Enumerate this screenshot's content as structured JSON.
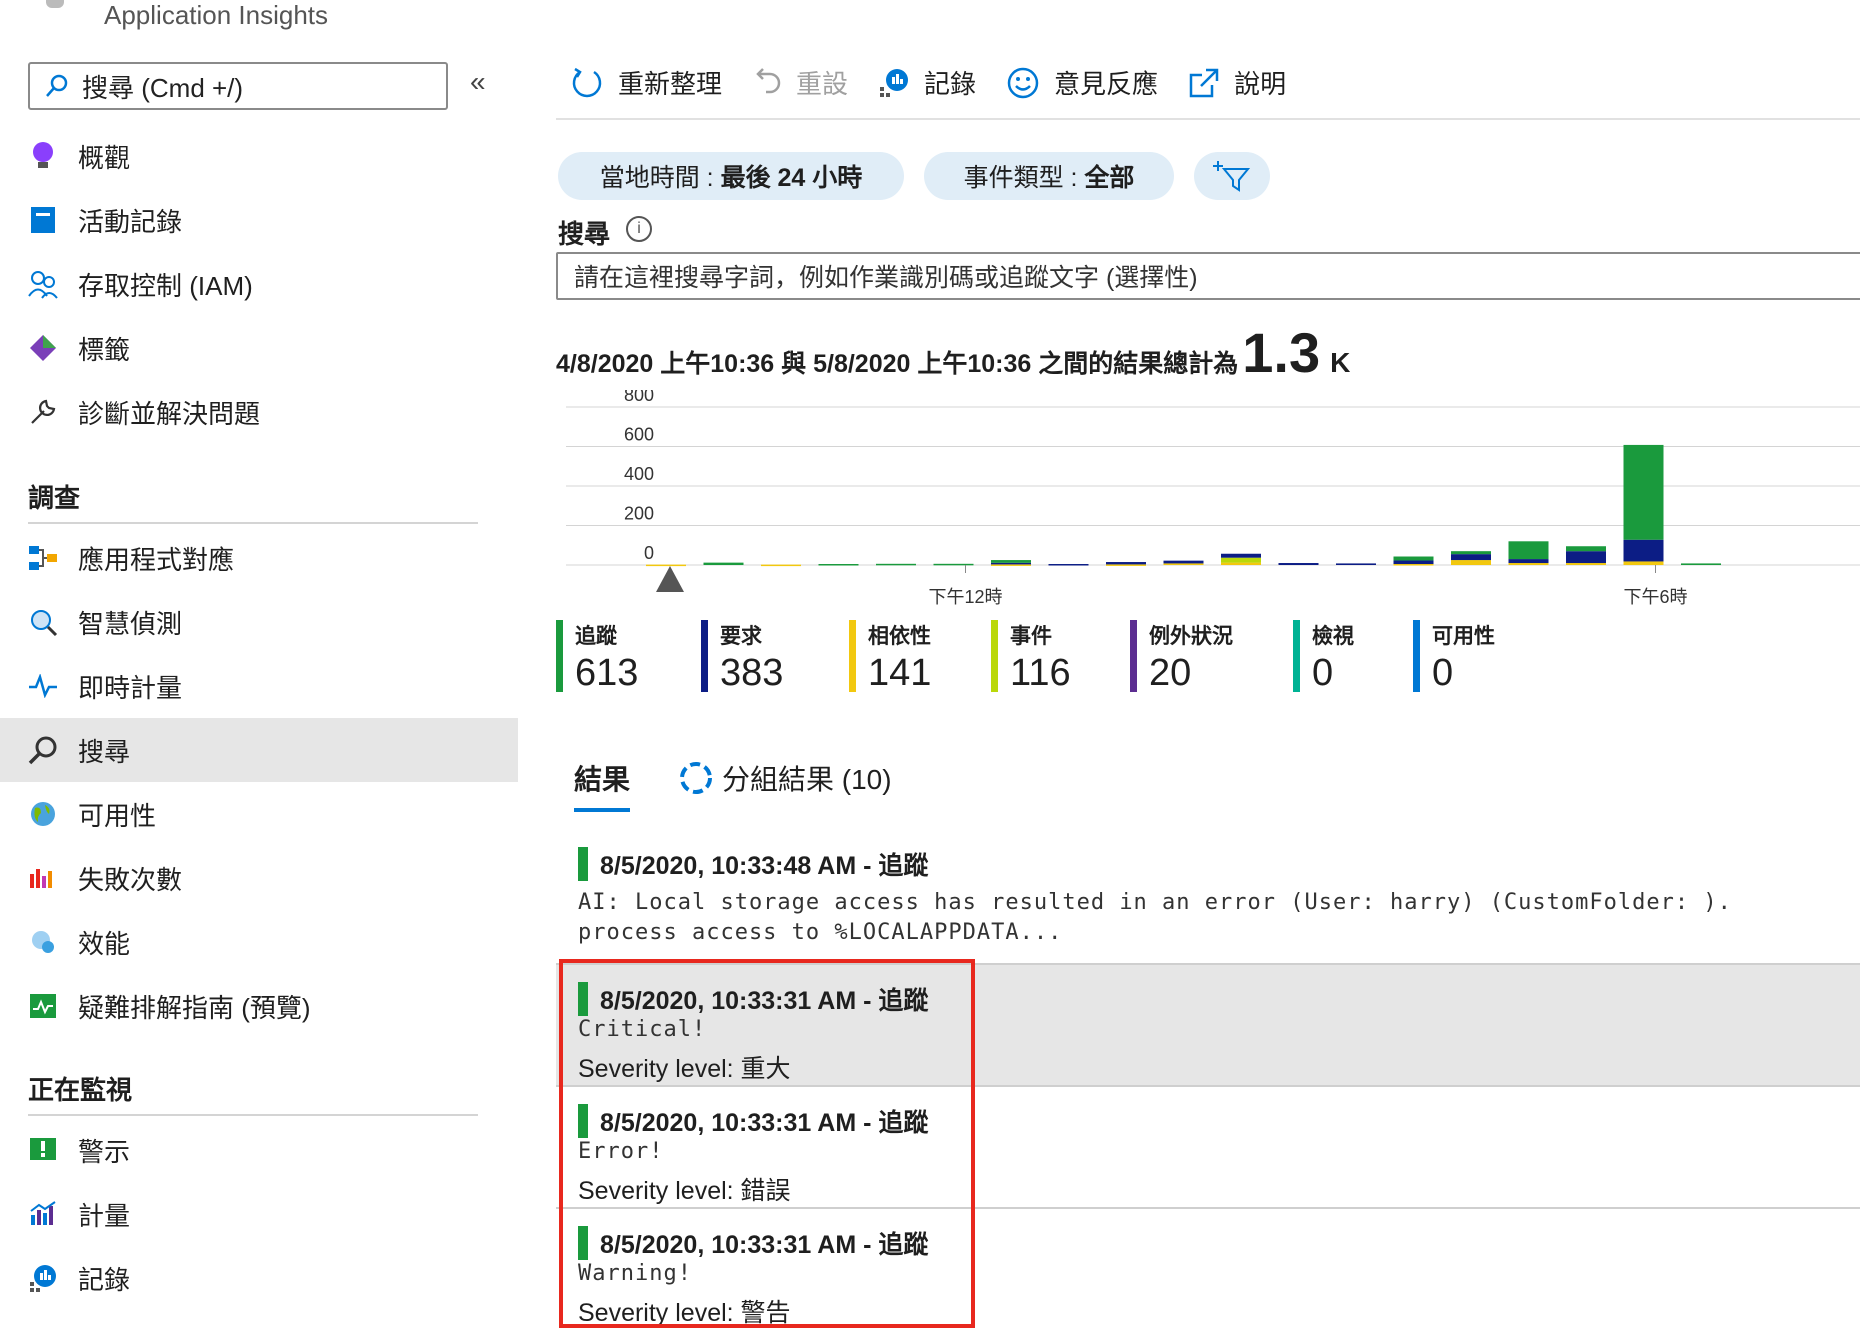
{
  "app": {
    "title": "Application Insights"
  },
  "sidebar": {
    "search_placeholder": "搜尋 (Cmd +/)",
    "collapse": "«",
    "items_top": [
      {
        "label": "概觀",
        "icon": "lightbulb-icon"
      },
      {
        "label": "活動記錄",
        "icon": "activity-log-icon"
      },
      {
        "label": "存取控制 (IAM)",
        "icon": "people-icon"
      },
      {
        "label": "標籤",
        "icon": "tag-icon"
      },
      {
        "label": "診斷並解決問題",
        "icon": "wrench-icon"
      }
    ],
    "section_investigate": "調查",
    "items_investigate": [
      {
        "label": "應用程式對應",
        "icon": "app-map-icon"
      },
      {
        "label": "智慧偵測",
        "icon": "smart-detection-icon"
      },
      {
        "label": "即時計量",
        "icon": "pulse-icon"
      },
      {
        "label": "搜尋",
        "icon": "search-icon"
      },
      {
        "label": "可用性",
        "icon": "globe-icon"
      },
      {
        "label": "失敗次數",
        "icon": "failures-icon"
      },
      {
        "label": "效能",
        "icon": "performance-icon"
      },
      {
        "label": "疑難排解指南 (預覽)",
        "icon": "troubleshoot-icon"
      }
    ],
    "section_monitoring": "正在監視",
    "items_monitoring": [
      {
        "label": "警示",
        "icon": "alert-icon"
      },
      {
        "label": "計量",
        "icon": "metrics-icon"
      },
      {
        "label": "記錄",
        "icon": "logs-icon"
      }
    ]
  },
  "toolbar": {
    "refresh": "重新整理",
    "reset": "重設",
    "logs": "記錄",
    "feedback": "意見反應",
    "help": "說明"
  },
  "filters": {
    "time_prefix": "當地時間 : ",
    "time_value": "最後 24 小時",
    "event_prefix": "事件類型 : ",
    "event_value": "全部"
  },
  "search": {
    "label": "搜尋",
    "placeholder": "請在這裡搜尋字詞，例如作業識別碼或追蹤文字 (選擇性)"
  },
  "summary": {
    "text": "4/8/2020 上午10:36 與 5/8/2020 上午10:36 之間的結果總計為",
    "total": "1.3",
    "unit": "K"
  },
  "chart_data": {
    "type": "bar",
    "stacked": true,
    "ylim": [
      0,
      800
    ],
    "y_ticks": [
      "800",
      "600",
      "400",
      "200",
      "0"
    ],
    "x_tick_labels": [
      "下午12時",
      "下午6時"
    ],
    "x_tick_positions": [
      5.5,
      17.5
    ],
    "bucket_count": 20,
    "colors": {
      "追蹤": "#1a9a3d",
      "要求": "#0c1d85",
      "相依性": "#f2c80f",
      "事件": "#bad80a"
    },
    "series": [
      {
        "name": "追蹤",
        "values": [
          0,
          12,
          0,
          5,
          6,
          6,
          14,
          0,
          0,
          0,
          0,
          0,
          0,
          20,
          15,
          90,
          25,
          480,
          8,
          0
        ]
      },
      {
        "name": "要求",
        "values": [
          0,
          0,
          0,
          0,
          0,
          0,
          8,
          5,
          12,
          14,
          20,
          10,
          8,
          18,
          30,
          20,
          60,
          110,
          0,
          0
        ]
      },
      {
        "name": "相依性",
        "values": [
          2,
          0,
          2,
          0,
          0,
          0,
          3,
          0,
          3,
          8,
          12,
          0,
          0,
          5,
          25,
          10,
          10,
          18,
          0,
          0
        ]
      },
      {
        "name": "事件",
        "values": [
          0,
          0,
          0,
          0,
          0,
          0,
          0,
          0,
          0,
          0,
          25,
          0,
          0,
          0,
          0,
          0,
          0,
          0,
          0,
          0
        ]
      }
    ]
  },
  "legend": [
    {
      "name": "追蹤",
      "value": "613",
      "color": "#1a9a3d"
    },
    {
      "name": "要求",
      "value": "383",
      "color": "#0c1d85"
    },
    {
      "name": "相依性",
      "value": "141",
      "color": "#f2c80f"
    },
    {
      "name": "事件",
      "value": "116",
      "color": "#bad80a"
    },
    {
      "name": "例外狀況",
      "value": "20",
      "color": "#5c2d91"
    },
    {
      "name": "檢視",
      "value": "0",
      "color": "#00b294"
    },
    {
      "name": "可用性",
      "value": "0",
      "color": "#0078d4"
    }
  ],
  "tabs": {
    "results": "結果",
    "grouped": "分組結果 (10)"
  },
  "results": [
    {
      "title": "8/5/2020, 10:33:48 AM - 追蹤",
      "line1": "AI: Local storage access has resulted in an error (User: harry) (CustomFolder: ). ",
      "line2": "process access to %LOCALAPPDATA..."
    },
    {
      "title": "8/5/2020, 10:33:31 AM - 追蹤",
      "message": "Critical!",
      "severity": "Severity level: 重大"
    },
    {
      "title": "8/5/2020, 10:33:31 AM - 追蹤",
      "message": "Error!",
      "severity": "Severity level: 錯誤"
    },
    {
      "title": "8/5/2020, 10:33:31 AM - 追蹤",
      "message": "Warning!",
      "severity": "Severity level: 警告"
    }
  ]
}
